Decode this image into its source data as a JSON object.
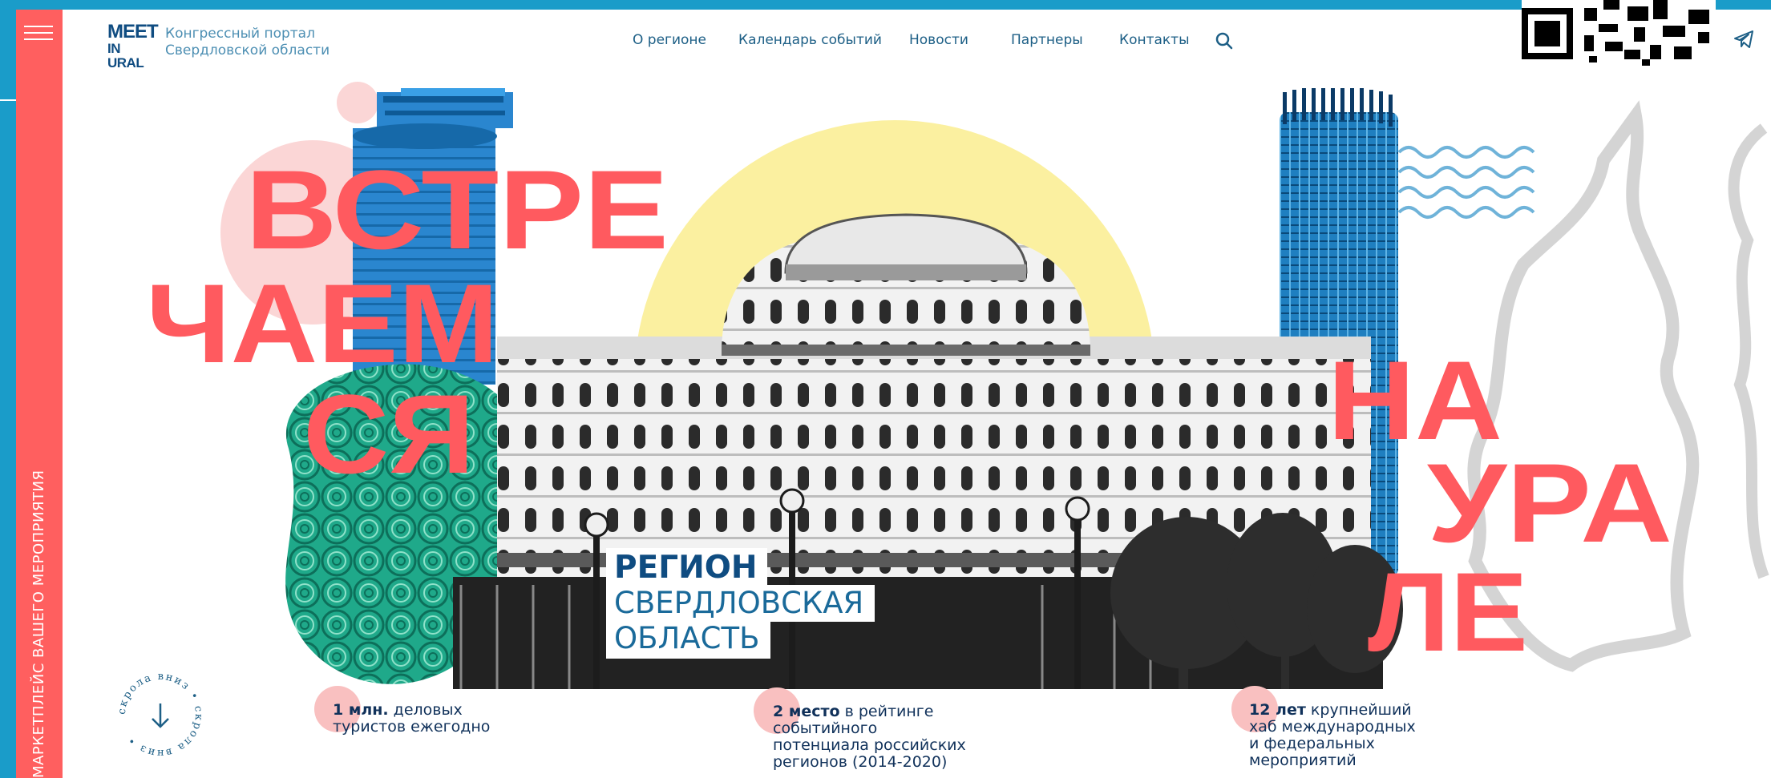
{
  "sidebar": {
    "menu_label": "",
    "vertical_text": "МАРКЕТПЛЕЙС ВАШЕГО МЕРОПРИЯТИЯ"
  },
  "header": {
    "logo_line1": "MEET",
    "logo_line2": "IN URAL",
    "tagline_line1": "Конгрессный портал",
    "tagline_line2": "Свердловской области",
    "nav": [
      "О регионе",
      "Календарь событий",
      "Новости",
      "Партнеры",
      "Контакты"
    ],
    "search_icon": "search-icon",
    "telegram_icon": "telegram-icon"
  },
  "hero": {
    "headline_left": [
      "ВСТРЕ",
      "ЧАЕМ",
      "СЯ"
    ],
    "headline_right": [
      "НА",
      "УРА",
      "ЛЕ"
    ],
    "region_label": "РЕГИОН",
    "region_name_line1": "СВЕРДЛОВСКАЯ",
    "region_name_line2": "ОБЛАСТЬ",
    "scroll_text": "скрола вниз"
  },
  "stats": [
    {
      "bold": "1 млн.",
      "rest_line1": " деловых",
      "rest_lines": [
        "туристов ежегодно"
      ]
    },
    {
      "bold": "2 место",
      "rest_line1": " в рейтинге",
      "rest_lines": [
        "событийного",
        "потенциала российских",
        "регионов (2014-2020)"
      ]
    },
    {
      "bold": "12 лет",
      "rest_line1": " крупнейший",
      "rest_lines": [
        "хаб международных",
        "и федеральных",
        "мероприятий"
      ]
    }
  ],
  "colors": {
    "accent_red": "#ff5f5f",
    "brand_blue": "#1a9cc9",
    "dark_blue": "#0f4c81",
    "sun_yellow": "#fbf0a0",
    "malachite": "#1fa98a"
  }
}
